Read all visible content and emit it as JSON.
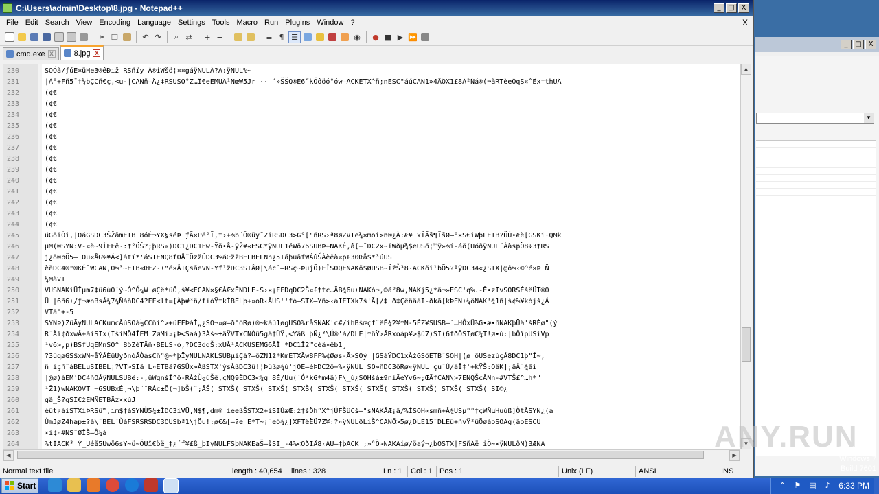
{
  "window": {
    "title": "C:\\Users\\admin\\Desktop\\8.jpg - Notepad++",
    "min": "_",
    "max": "□",
    "close": "X"
  },
  "menu": {
    "items": [
      "File",
      "Edit",
      "Search",
      "View",
      "Encoding",
      "Language",
      "Settings",
      "Tools",
      "Macro",
      "Run",
      "Plugins",
      "Window",
      "?"
    ],
    "close": "X"
  },
  "tabs": [
    {
      "label": "cmd.exe",
      "active": false
    },
    {
      "label": "8.jpg",
      "active": true
    }
  ],
  "editor": {
    "lines": [
      {
        "num": "230",
        "text": "SOÓã/ƒúE¤üHe3®êÐiž RSñïy¦Ã®iWšö¦¤¤gáÿNULÃ?Ä:ÿNUL%~"
      },
      {
        "num": "231",
        "text": "|À°+Fñ5¯†¼bÇCñ€ç,<u-|CANñ—Å¿‡RSUSO°Z…Î€eEMUÃ¹NœW5Jr ··  ´»ŠŠQ®E6˝kÓôöó°ów—ACKETX^ñ;nESC\"áúCAN1»4ÅÕX1£8Á²Ñá®(¬ãRTèeÕqS«ˆÊx†thUÃ"
      },
      {
        "num": "232",
        "text": "(¢€"
      },
      {
        "num": "233",
        "text": "(¢€"
      },
      {
        "num": "234",
        "text": "(¢€"
      },
      {
        "num": "235",
        "text": "(¢€"
      },
      {
        "num": "236",
        "text": "(¢€"
      },
      {
        "num": "237",
        "text": "(¢€"
      },
      {
        "num": "238",
        "text": "(¢€"
      },
      {
        "num": "239",
        "text": "(¢€"
      },
      {
        "num": "240",
        "text": "(¢€"
      },
      {
        "num": "241",
        "text": "(¢€"
      },
      {
        "num": "242",
        "text": "(¢€"
      },
      {
        "num": "243",
        "text": "(¢€"
      },
      {
        "num": "244",
        "text": "(¢€"
      },
      {
        "num": "245",
        "text": "úGöiÒi,|OáGSDC3ŠŽãmETB_8óÉ¬YX§séÞ ƒÃ×Pë°Ï,t›+%b´Ô®üy¯ZiRSDC3>G°[\"ñRS›ª8øZVTe¼×moi>n®¿À:Æ¥ xÏÃš¶ÏšØ—°×S€iWþLETB?ÜÚ•Æë[GSKi·QMk"
      },
      {
        "num": "246",
        "text": "µM(®SYN:V-¤ë~9ÌFFë·:†°ÖŠ?;þRS«)DC1¿DC1Ew-Ÿö•Å-ÿŽ¥«ESC*ÿNUL1éWö76SUBÞ+NAKÉ,â[+¯DC2x~ïWðµ¾$eUSö¦™ÿ»%í-áö(UóðÿNUL´ÀàspÖ8÷3†RS"
      },
      {
        "num": "247",
        "text": "j¿ö®bÖ5—_Ou«ÅG%¥Á<]átï*'áSIENQ8fOÅ˜ÕzžÜDC3%áŒžžBELBELNn¿5IáþuãfWÁûŠÀèêà«p£30Œå$*³úUS"
      },
      {
        "num": "248",
        "text": "èëDC4®\"®KÉ¯WCAN,O%³~ETB«ŒEZ·±\"ë×ÂTÇsãeVN-Yf¹žDC3SIÂØ|\\ácˆ—RSç~ÞµjÕ)FÎSOQENAKõ$ØUSB~ÏžŠ³8·ACKõi¹bÕ5?ªÿDC34«¿STX|@ô%‹©^é×Þ'Ñ"
      },
      {
        "num": "249",
        "text": "¼MãVT"
      },
      {
        "num": "250",
        "text": "VUSNAKiÜÎµm7‡ü6úO´ý~Ó^Ó¼W øÇê*üÕ,š¥<ECAN×§€ÀÆxÊNDLE-S›×¡FFDqDC2Š¤£†tc…ÃB¾6u±NAKò¬,©ã°8w,NAKj5¿*â¬»ESC'q%.-Ê•zIvSORSÉšêÜT®O"
      },
      {
        "num": "251",
        "text": "Ü_|6ñ6±/ƒ¬ænBsÂ¼7¾ÑàñDC4?FF<lt=[Àþ#³ñ/fióŸtkÍBELþ+¤oR‹ÂUS''fó—STX—Yñ>‹áIETXk7š'Ã[/‡    ð‡ÇëñãáI-ðkã[kÞEN±¼öNAK'¾1ñ|š¢%¥kójš¿Á'"
      },
      {
        "num": "252",
        "text": "VTà'+-5"
      },
      {
        "num": "253",
        "text": "SYNÞ)ZûÃyNULACKumcÂùSOá½CCñi^>+üFFÞáÌ„¿SO¬¤ø—ð\"öRø)®~kàù1øgUSO%råSNAK'c#/ihBšœçf¨êÉ¾2¥*N-5ÉZ¥SUSB—´…HÔxÜ%G•æ•ñNAKþÜä'šRÈø\"(ý"
      },
      {
        "num": "254",
        "text": "R¯Àì¢ðxwÂ+ãiSIx(IšiMÕ4ÎEM|ZøMi¤¡Þ<Saá)3Àš~±ãŸVTxCNÒü5gâ†ÜŸ,<Yãß    þÑ¿³\\Ú®'á/DLE|*ñŸ›ÃRxoáp¥>$ü7)SI(6fðÕSIøC¼T!ø•ù:|bÔîpUSiVp"
      },
      {
        "num": "255",
        "text": "¹v6>,p)BSfUqEMnSO^ 8öZéTÃñ·BELS¤ó,?DC3dqŠ:xUÅ¹ACKUSEMG6ÂÏ     *DC1Î2™céâ¤ëb1¸"
      },
      {
        "num": "256",
        "text": "?3üqøGS$xWN~åÝÂÈüUyðnóÃÒàsCñ°@~*þÏyNULNAKLSUBµiÇà?—ôZN1ž*KmETXÃw8FF%¢Øøs-Ã>SOý |GSáŸDC1xÂžGSôETB¯SOH|(ø ôUSezúçÂ8DC1þ\"Î~,"
      },
      {
        "num": "257",
        "text": "ñ_içñ¨àBELuSIBEL¡?VT>SIã|L¤ETBã?GSÛx»ÀßSTX'ýsÂßDC3ü!¦Þüßø¾ù'jOE—éÞDC2ö=%‹ÿNUL    SO»ñDC3ôRø«ÿNUL     çu¯Ú/àÎ‡'+kŸŠ:OäK];âÂ¯¾ãi"
      },
      {
        "num": "258",
        "text": "|@ø)áEM'DC4ñOÂÿNULSUBê:-,üWgnšÍ^ô-RÀžÙ¼úŠê,çNQ9ÈDC3<¼g      8É/Uu(´Ó³kG*m4ã)F\\_ù¿SOHšà±9niÃeYv6~;ŒÃfCAN\\>7ENQŠcÂNn-#VTŠ£^…h*\""
      },
      {
        "num": "259",
        "text": "¹Ž1)wNAKOVT    ¬6SUBxÉ¸¬\\þ¨¨RÁc±Õ(¬]bŠ(¨;ÃŠ( STXŠ( STXŠ( STXŠ( STXŠ( STXŠ( STXŠ( STXŠ( STXŠ( STXŠ( STXŠ( STXŠ( SI©¿"
      },
      {
        "num": "260",
        "text": "gã_Š?gSI€žEMÑETBÃz×xúJ"
      },
      {
        "num": "261",
        "text": "èût¿àiSTXiÞRSü™,im$†áSYNÙ5¼±ÎDC3iVÜ,N$¶,dm® ieeßŠSTX2+iSIÙæŒ:ž†šÖh°X^jÚFŠüCš—\"sNAKÅÆ¡â/%ÍSOH«smñ+Â¾USµ°°†çWÑµHuùß]ÒtÂSYN¿(a"
      },
      {
        "num": "262",
        "text": "ÙmJøZ4hap±?ã\\¯BEL´ÙáFSRSRSDC3OUSbª1\\jÖu!:ø€&[—?e  E*T~¡¯eô¾¿]XFTêËÜ7Z¥:?¤ÿNULðLiŠ^CANÕ>5ø¿DLE15¯DLEü+ñvŸ²üÖøàoSOAg(ãoESCU"
      },
      {
        "num": "263",
        "text": "×i¢¤#NS¨ØÎŠ–Ô¼à"
      },
      {
        "num": "264",
        "text": "%tÎACK³ Ý_Üéã5Uwö6sY~ü~ÓÜî€öë_‡¿´f¥£ß_þÏyNULFSþNAKEaŠ–šSI_-4%<OðIÅ8‹ÀÜ—‡þACK|;»°Ò>NAKÁiø/öaý¬¿bOSTX|FSñÃë iÒ~×ÿNULðN)3ÆNA"
      }
    ]
  },
  "status": {
    "filetype": "Normal text file",
    "length": "length : 40,654",
    "lines": "lines : 328",
    "ln": "Ln : 1",
    "col": "Col : 1",
    "pos": "Pos : 1",
    "eol": "Unix (LF)",
    "encoding": "ANSI",
    "ins": "INS"
  },
  "taskbar": {
    "start": "Start",
    "clock": "6:33 PM"
  },
  "desktop": {
    "watermark": "ANY.RUN",
    "test_mode": "Test Mode",
    "os": "Windows 7",
    "build": "Build 7601"
  }
}
